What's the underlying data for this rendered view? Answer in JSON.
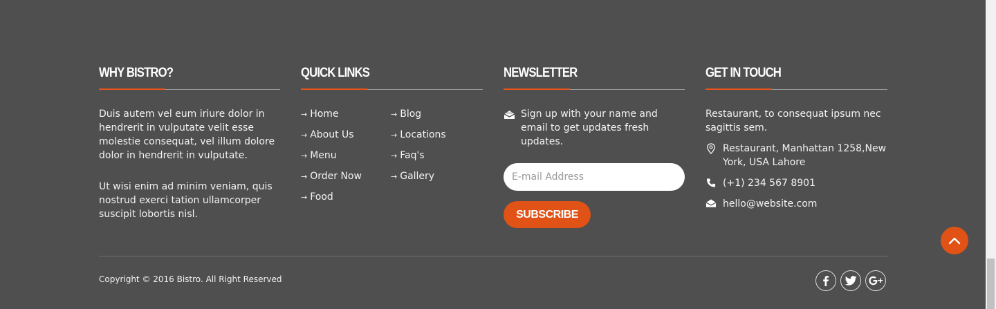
{
  "why": {
    "heading": "WHY BISTRO?",
    "paragraph1": "Duis autem vel eum iriure dolor in hendrerit in vulputate velit esse molestie consequat, vel illum dolore dolor in hendrerit in vulputate.",
    "paragraph2": "Ut wisi enim ad minim veniam, quis nostrud exerci tation ullamcorper suscipit lobortis nisl."
  },
  "quick_links": {
    "heading": "QUICK LINKS",
    "arrow": "→",
    "col1": [
      "Home",
      "About Us",
      "Menu",
      "Order Now",
      "Food"
    ],
    "col2": [
      "Blog",
      "Locations",
      "Faq's",
      "Gallery"
    ]
  },
  "newsletter": {
    "heading": "NEWSLETTER",
    "description": "Sign up with your name and email to get updates fresh updates.",
    "icon": "envelope-open-icon",
    "email_placeholder": "E-mail Address",
    "email_value": "",
    "subscribe_label": "SUBSCRIBE"
  },
  "contact": {
    "heading": "GET IN TOUCH",
    "intro": "Restaurant, to consequat ipsum nec sagittis sem.",
    "address": "Restaurant, Manhattan 1258,New York, USA Lahore",
    "phone": "(+1) 234 567 8901",
    "email": "hello@website.com",
    "icons": [
      "map-marker-icon",
      "phone-icon",
      "envelope-icon"
    ]
  },
  "footer": {
    "copyright": "Copyright © 2016 Bistro. All Right Reserved",
    "social": [
      "facebook-icon",
      "twitter-icon",
      "google-plus-icon"
    ]
  },
  "colors": {
    "background": "#4f4f4f",
    "accent": "#e05216",
    "text": "#f2f2f2"
  }
}
